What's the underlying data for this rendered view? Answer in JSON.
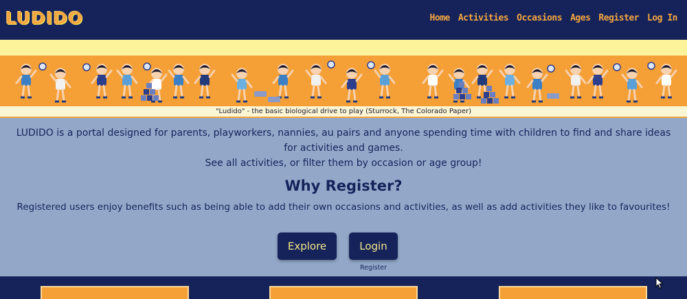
{
  "app": {
    "logo": "LUDIDO"
  },
  "nav": {
    "items": [
      "Home",
      "Activities",
      "Occasions",
      "Ages",
      "Register",
      "Log In"
    ]
  },
  "banner": {
    "caption": "\"Ludido\" - the basic biological drive to play (Sturrock, The Colorado Paper)"
  },
  "intro": {
    "line1": "LUDIDO is a portal designed for parents, playworkers, nannies, au pairs and anyone spending time with children to find and share ideas for activities and games.",
    "line2": "See all activities, or filter them by occasion or age group!"
  },
  "why": {
    "title": "Why Register?",
    "text": "Registered users enjoy benefits such as being able to add their own occasions and activities, as well as add activities they like to favourites!"
  },
  "buttons": {
    "explore": "Explore",
    "login": "Login",
    "register": "Register"
  },
  "colors": {
    "navy": "#15235a",
    "orange": "#f5a037",
    "page_bg": "#93a8c9",
    "banner_yellow": "#fdf39a"
  }
}
